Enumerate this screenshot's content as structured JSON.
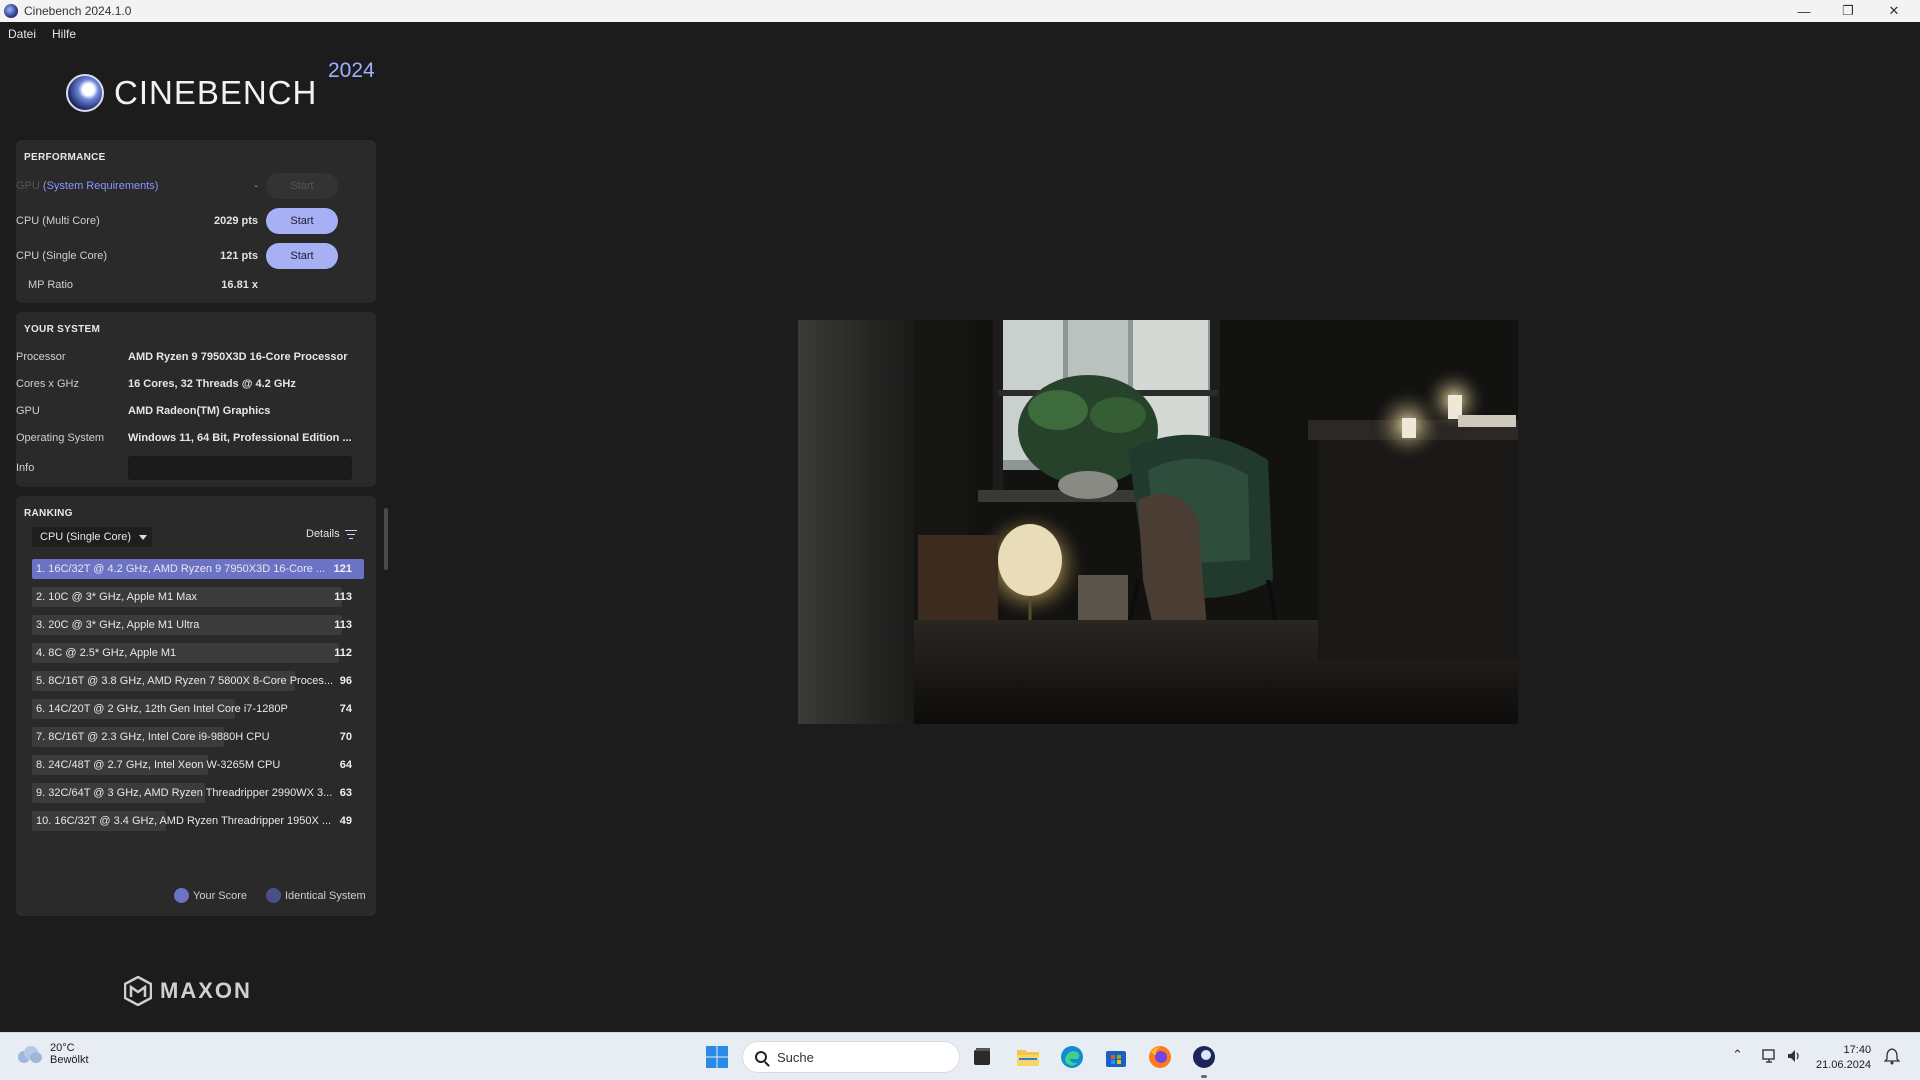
{
  "window": {
    "title": "Cinebench 2024.1.0",
    "minimize": "—",
    "maximize": "❐",
    "close": "✕"
  },
  "menu": {
    "file": "Datei",
    "help": "Hilfe"
  },
  "logo": {
    "text": "CINEBENCH",
    "year": "2024"
  },
  "performance": {
    "title": "PERFORMANCE",
    "gpu": {
      "prefix": "GPU",
      "link": "(System Requirements)",
      "value": "-",
      "button": "Start",
      "enabled": false
    },
    "cpu_multi": {
      "label": "CPU (Multi Core)",
      "value": "2029 pts",
      "button": "Start"
    },
    "cpu_single": {
      "label": "CPU (Single Core)",
      "value": "121 pts",
      "button": "Start"
    },
    "mp_ratio": {
      "label": "MP Ratio",
      "value": "16.81 x"
    }
  },
  "system": {
    "title": "YOUR SYSTEM",
    "rows": [
      {
        "label": "Processor",
        "value": "AMD Ryzen 9 7950X3D 16-Core Processor"
      },
      {
        "label": "Cores x GHz",
        "value": "16 Cores, 32 Threads @ 4.2 GHz"
      },
      {
        "label": "GPU",
        "value": "AMD Radeon(TM) Graphics"
      },
      {
        "label": "Operating System",
        "value": "Windows 11, 64 Bit, Professional Edition ..."
      }
    ],
    "info_label": "Info"
  },
  "ranking": {
    "title": "RANKING",
    "selected": "CPU (Single Core)",
    "details": "Details",
    "rows": [
      {
        "text": "1. 16C/32T @ 4.2 GHz, AMD Ryzen 9 7950X3D 16-Core ...",
        "score": "121",
        "fraction": 1.0,
        "highlight": true
      },
      {
        "text": "2. 10C @ 3* GHz, Apple M1 Max",
        "score": "113",
        "fraction": 0.934,
        "highlight": false
      },
      {
        "text": "3. 20C @ 3* GHz, Apple M1 Ultra",
        "score": "113",
        "fraction": 0.934,
        "highlight": false
      },
      {
        "text": "4. 8C @ 2.5* GHz, Apple M1",
        "score": "112",
        "fraction": 0.926,
        "highlight": false
      },
      {
        "text": "5. 8C/16T @ 3.8 GHz, AMD Ryzen 7 5800X 8-Core Proces...",
        "score": "96",
        "fraction": 0.793,
        "highlight": false
      },
      {
        "text": "6. 14C/20T @ 2 GHz, 12th Gen Intel Core i7-1280P",
        "score": "74",
        "fraction": 0.612,
        "highlight": false
      },
      {
        "text": "7. 8C/16T @ 2.3 GHz, Intel Core i9-9880H CPU",
        "score": "70",
        "fraction": 0.579,
        "highlight": false
      },
      {
        "text": "8. 24C/48T @ 2.7 GHz, Intel Xeon W-3265M CPU",
        "score": "64",
        "fraction": 0.529,
        "highlight": false
      },
      {
        "text": "9. 32C/64T @ 3 GHz, AMD Ryzen Threadripper 2990WX 3...",
        "score": "63",
        "fraction": 0.521,
        "highlight": false
      },
      {
        "text": "10. 16C/32T @ 3.4 GHz, AMD Ryzen Threadripper 1950X ...",
        "score": "49",
        "fraction": 0.405,
        "highlight": false
      }
    ],
    "legend": {
      "your_score": "Your Score",
      "identical": "Identical System"
    }
  },
  "maxon": {
    "text": "MAXON"
  },
  "colors": {
    "accent": "#a8b0f5",
    "highlight_bar": "#6c73c6",
    "bar": "#3b3b3b",
    "year": "#9fb0ff",
    "your_score_dot": "#6c73c6",
    "identical_dot": "#4a4f8a"
  },
  "taskbar": {
    "weather": {
      "temp": "20°C",
      "condition": "Bewölkt"
    },
    "search": "Suche",
    "clock": {
      "time": "17:40",
      "date": "21.06.2024"
    }
  }
}
